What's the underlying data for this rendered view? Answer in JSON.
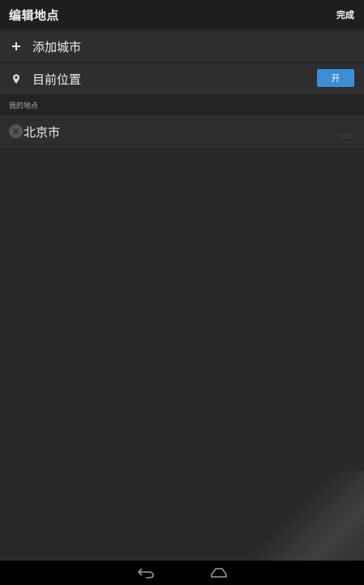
{
  "action_bar": {
    "title": "编辑地点",
    "done_label": "完成"
  },
  "add_city": {
    "icon": "plus-icon",
    "label": "添加城市"
  },
  "current_location": {
    "icon": "location-pin-icon",
    "label": "目前位置",
    "toggle_label": "开",
    "toggle_color": "#3a8dd6"
  },
  "my_places": {
    "header": "我的地点",
    "cities": [
      {
        "name": "北京市",
        "remove_icon": "remove-circle-icon",
        "handle_icon": "drag-handle-icon"
      }
    ]
  },
  "nav_bar": {
    "back_icon": "back-icon",
    "home_icon": "home-icon"
  }
}
